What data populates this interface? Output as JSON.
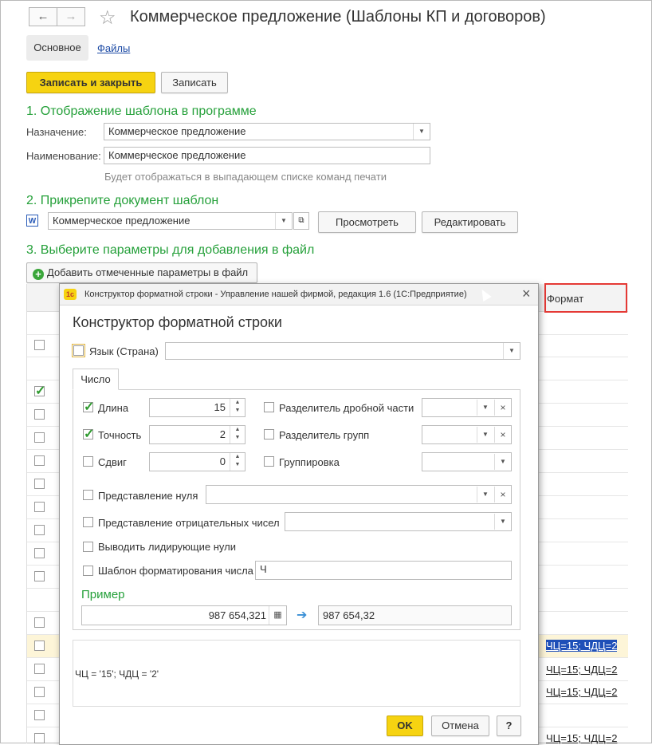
{
  "window": {
    "title": "Коммерческое предложение (Шаблоны КП и договоров)",
    "nav_back": "←",
    "nav_forward": "→",
    "star": "☆"
  },
  "tabs": {
    "main": "Основное",
    "files": "Файлы"
  },
  "toolbar": {
    "save_close": "Записать и закрыть",
    "save": "Записать"
  },
  "section1": {
    "heading": "1. Отображение шаблона в программе",
    "purpose_label": "Назначение:",
    "purpose_value": "Коммерческое предложение",
    "name_label": "Наименование:",
    "name_value": "Коммерческое предложение",
    "hint": "Будет отображаться в выпадающем списке команд печати"
  },
  "section2": {
    "heading": "2. Прикрепите документ шаблон",
    "doc_value": "Коммерческое предложение",
    "preview": "Просмотреть",
    "edit": "Редактировать"
  },
  "section3": {
    "heading": "3. Выберите параметры для добавления в файл",
    "add_button": "Добавить отмеченные параметры в файл",
    "format_header": "Формат",
    "format_cells": [
      "ЧЦ=15; ЧДЦ=2",
      "ЧЦ=15; ЧДЦ=2",
      "ЧЦ=15; ЧДЦ=2",
      "ЧЦ=15; ЧДЦ=2"
    ]
  },
  "dialog": {
    "window_title": "Конструктор форматной строки - Управление нашей фирмой, редакция 1.6  (1С:Предприятие)",
    "app_badge": "1с",
    "close": "×",
    "heading": "Конструктор форматной строки",
    "language_label": "Язык (Страна)",
    "tab_number": "Число",
    "length_label": "Длина",
    "length_value": "15",
    "precision_label": "Точность",
    "precision_value": "2",
    "shift_label": "Сдвиг",
    "shift_value": "0",
    "decimal_sep_label": "Разделитель дробной части",
    "group_sep_label": "Разделитель групп",
    "grouping_label": "Группировка",
    "zero_repr_label": "Представление нуля",
    "negative_repr_label": "Представление отрицательных чисел",
    "leading_zeros_label": "Выводить лидирующие нули",
    "template_label": "Шаблон форматирования числа",
    "template_value": "Ч",
    "example_heading": "Пример",
    "example_input": "987 654,321",
    "example_output": "987 654,32",
    "result_string": "ЧЦ = '15'; ЧДЦ = '2'",
    "ok": "OK",
    "cancel": "Отмена",
    "help": "?"
  },
  "colors": {
    "accent_green": "#25a03a",
    "button_yellow": "#f6d311",
    "highlight_red": "#e53935",
    "selection_blue": "#1e4fb8"
  }
}
